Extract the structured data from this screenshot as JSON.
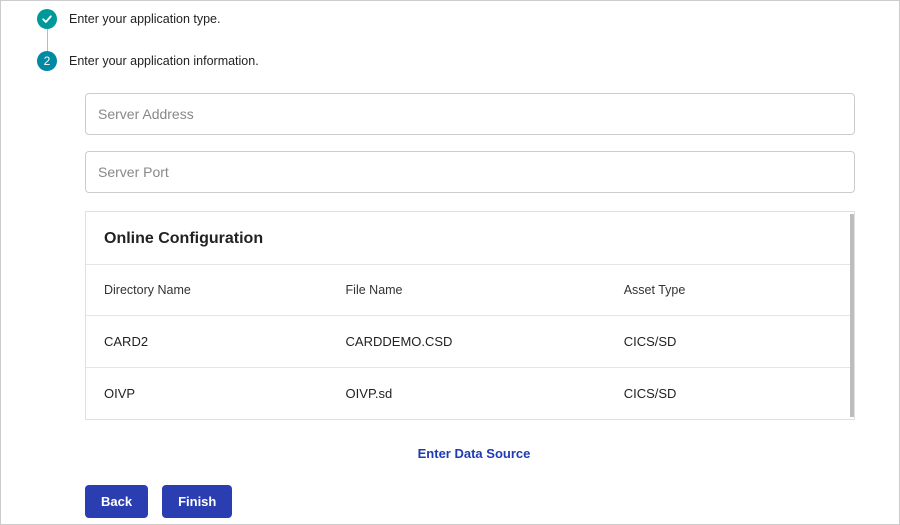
{
  "steps": {
    "step1": {
      "label": "Enter your application type."
    },
    "step2": {
      "number": "2",
      "label": "Enter your application information."
    }
  },
  "inputs": {
    "server_address": {
      "placeholder": "Server Address",
      "value": ""
    },
    "server_port": {
      "placeholder": "Server Port",
      "value": ""
    }
  },
  "config": {
    "title": "Online Configuration",
    "columns": {
      "dir": "Directory Name",
      "file": "File Name",
      "asset": "Asset Type"
    },
    "rows": [
      {
        "dir": "CARD2",
        "file": "CARDDEMO.CSD",
        "asset": "CICS/SD"
      },
      {
        "dir": "OIVP",
        "file": "OIVP.sd",
        "asset": "CICS/SD"
      }
    ]
  },
  "data_source_link": "Enter Data Source",
  "buttons": {
    "back": "Back",
    "finish": "Finish"
  }
}
